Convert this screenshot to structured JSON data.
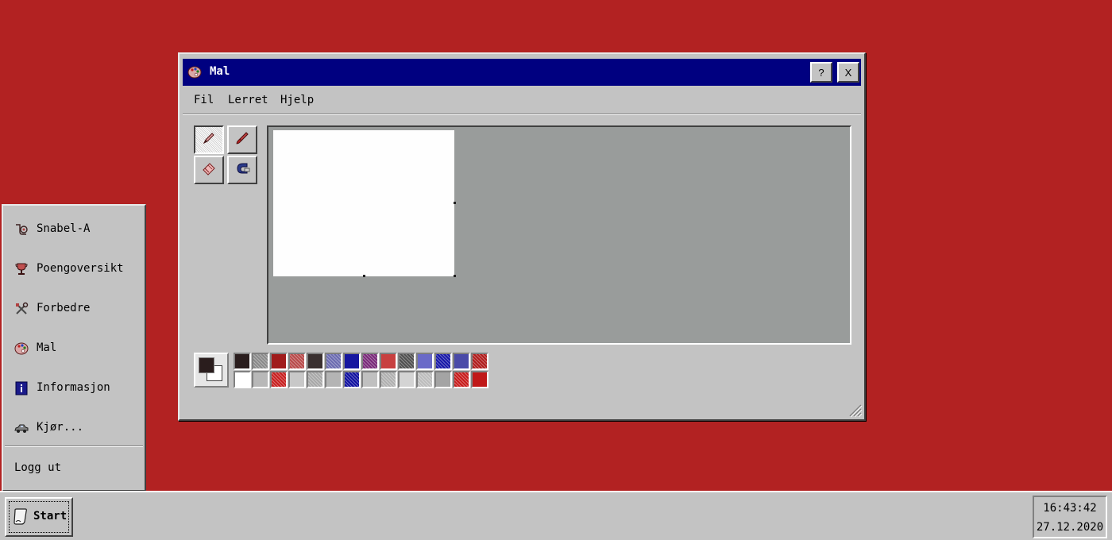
{
  "window": {
    "title": "Mal",
    "help_button": "?",
    "close_button": "X",
    "menu": [
      "Fil",
      "Lerret",
      "Hjelp"
    ],
    "tools": [
      {
        "name": "pencil",
        "icon": "pencil-icon",
        "active": true
      },
      {
        "name": "brush",
        "icon": "brush-icon",
        "active": false
      },
      {
        "name": "eraser",
        "icon": "eraser-icon",
        "active": false
      },
      {
        "name": "fill",
        "icon": "fill-bucket-icon",
        "active": false
      }
    ],
    "foreground_color": "#2a1d1d",
    "background_color": "#ffffff",
    "palette": [
      [
        "#2a1d1d",
        "#8a8a8a",
        "#a01c1c",
        "#b84a4a",
        "#3a3030",
        "#6a6ab0",
        "#1616a0",
        "#7a2a7a",
        "#c84040",
        "#505050",
        "#6a6ac8",
        "#1818a8",
        "#4a4aa8",
        "#b01c1c"
      ],
      [
        "#ffffff",
        "#b8b8b8",
        "#c82020",
        "#c8c8c8",
        "#a8a8a8",
        "#b4b4b4",
        "#1010a0",
        "#c0c0c0",
        "#b0b0b0",
        "#d4d4d4",
        "#bcbcbc",
        "#a4a4a4",
        "#c81c1c",
        "#c01818"
      ]
    ]
  },
  "start_menu": {
    "items": [
      {
        "label": "Snabel-A",
        "icon": "mail-horn-icon"
      },
      {
        "label": "Poengoversikt",
        "icon": "trophy-icon"
      },
      {
        "label": "Forbedre",
        "icon": "tools-icon"
      },
      {
        "label": "Mal",
        "icon": "palette-icon"
      },
      {
        "label": "Informasjon",
        "icon": "info-icon"
      },
      {
        "label": "Kjør...",
        "icon": "car-icon"
      }
    ],
    "logout": "Logg ut"
  },
  "taskbar": {
    "start_label": "Start",
    "time": "16:43:42",
    "date": "27.12.2020"
  }
}
